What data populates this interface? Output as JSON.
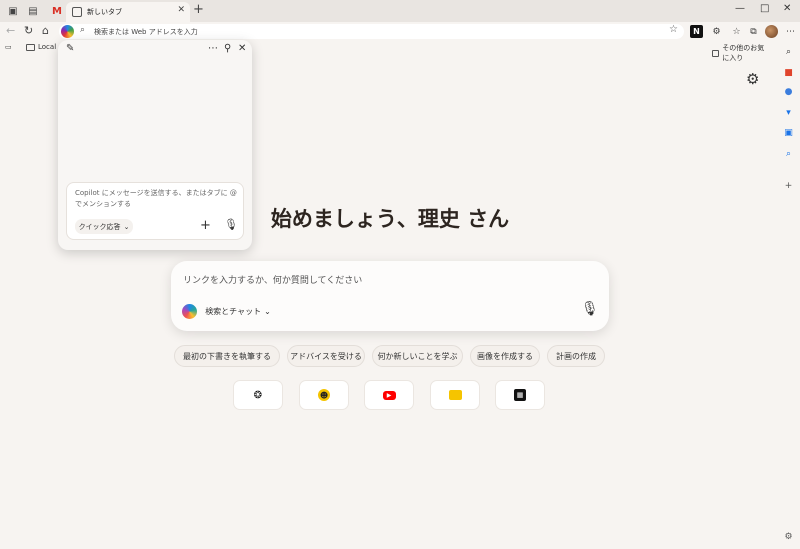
{
  "browser": {
    "tab_title": "新しいタブ",
    "address_placeholder": "検索または Web アドレスを入力",
    "tab_close": "✕",
    "new_tab": "+"
  },
  "bookmarks": {
    "local": "Local",
    "other_favorites": "その他のお気に入り"
  },
  "copilot": {
    "input_placeholder": "Copilot にメッセージを送信する、またはタブに @ でメンションする",
    "mode_label": "クイック応答"
  },
  "main": {
    "greeting": "始めましょう、理史 さん",
    "search_placeholder": "リンクを入力するか、何か質問してください",
    "mode_label": "検索とチャット",
    "chips": [
      "最初の下書きを執筆する",
      "アドバイスを受ける",
      "何か新しいことを学ぶ",
      "画像を作成する",
      "計画の作成"
    ]
  },
  "tiles": [
    {
      "name": "openai-icon",
      "color": "#111111"
    },
    {
      "name": "face-icon",
      "color": "#f5c400"
    },
    {
      "name": "youtube-icon",
      "color": "#ff0000"
    },
    {
      "name": "news-icon",
      "color": "#f5c400"
    },
    {
      "name": "image-site-icon",
      "color": "#111111"
    }
  ],
  "colors": {
    "background": "#f7f4f1",
    "tabbar": "#e9e5e1"
  }
}
